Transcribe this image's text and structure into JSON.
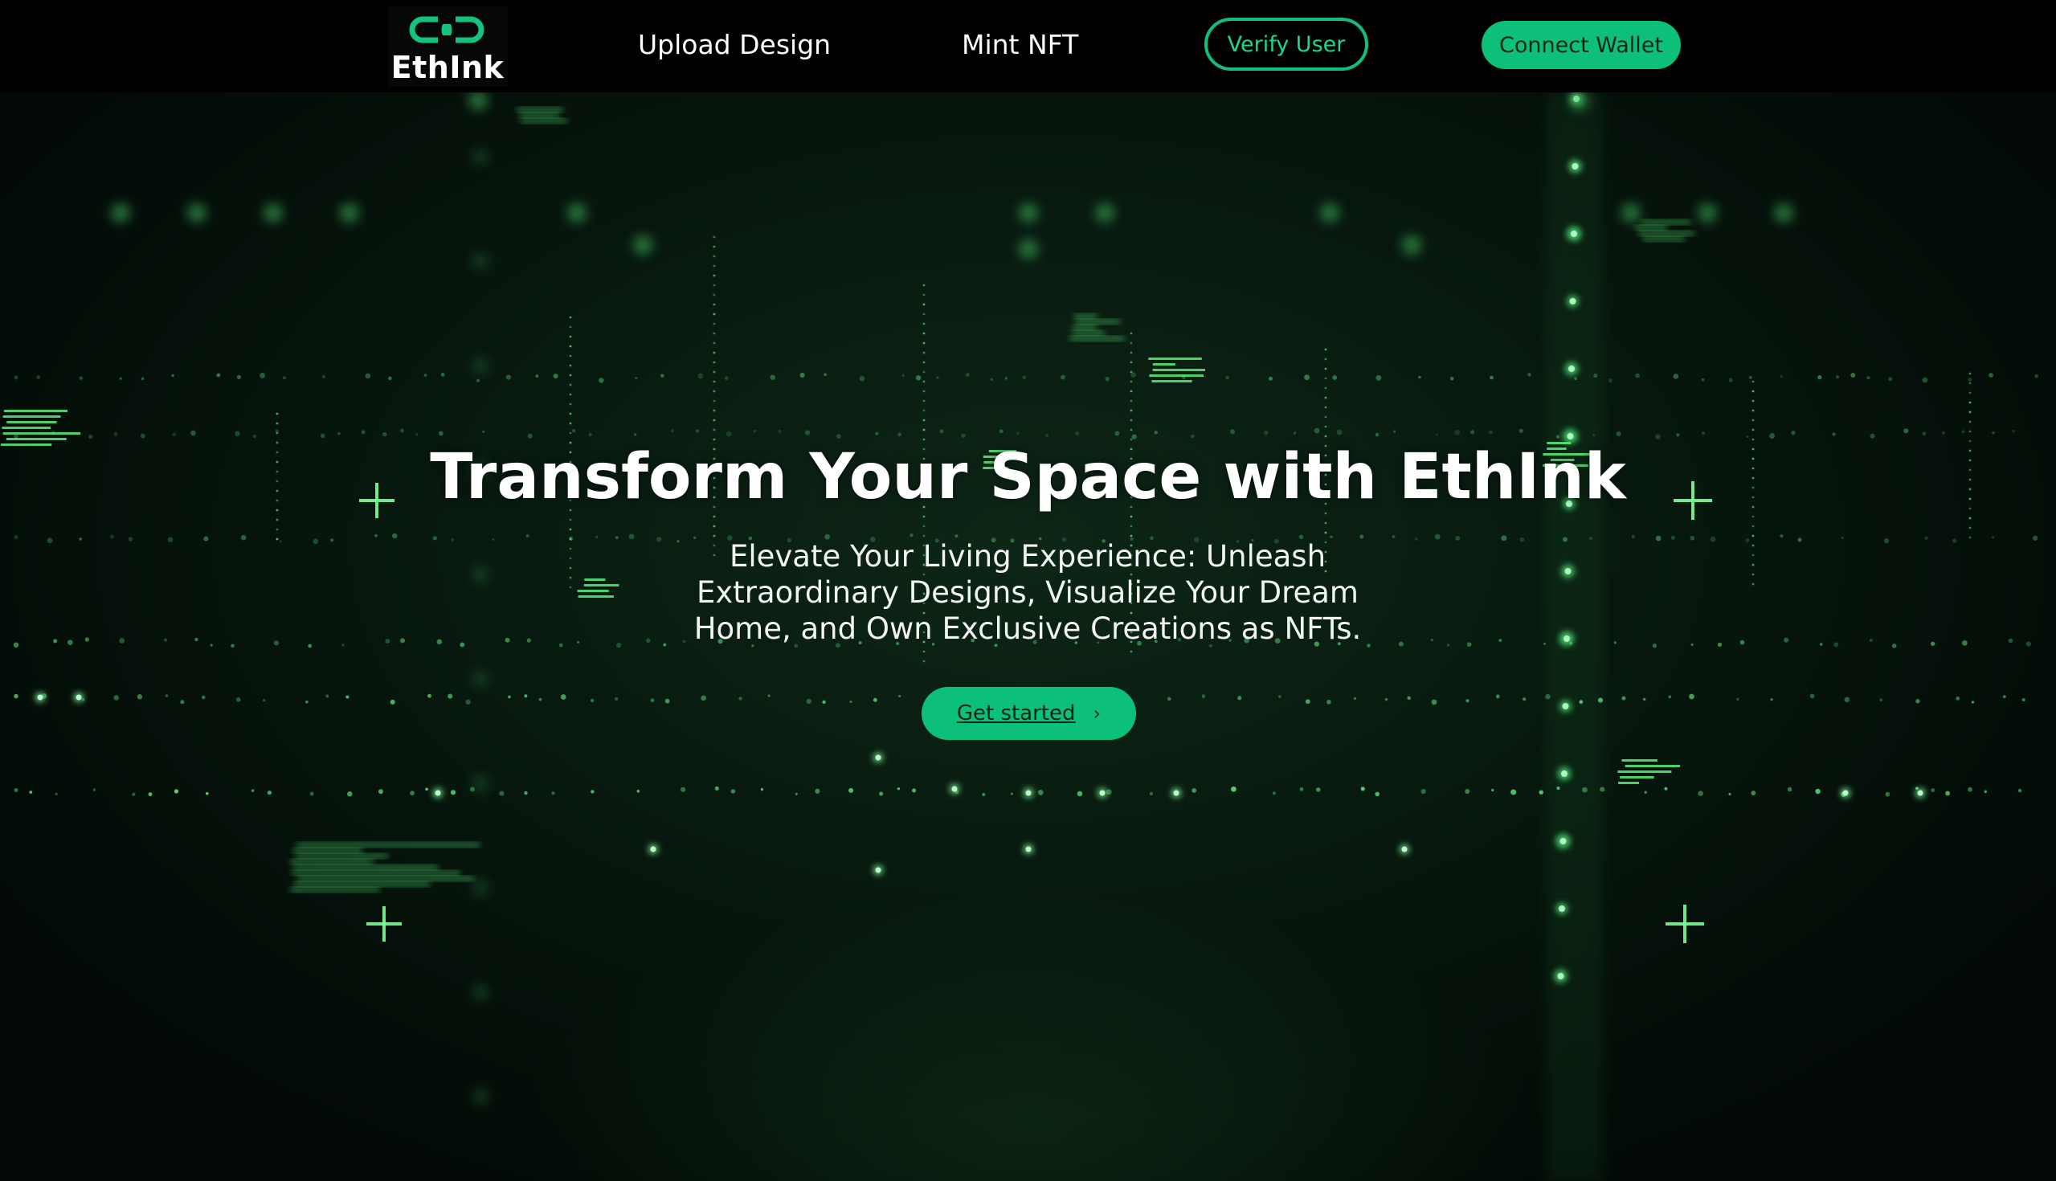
{
  "brand": {
    "name": "EthInk",
    "logo_icon": "chain-link-icon",
    "accent": "#0cc07a"
  },
  "nav": {
    "links": [
      "Upload Design",
      "Mint NFT"
    ],
    "verify_label": "Verify User",
    "connect_label": "Connect Wallet"
  },
  "hero": {
    "title": "Transform Your Space with EthInk",
    "subtitle": "Elevate Your Living Experience: Unleash Extraordinary Designs, Visualize Your Dream Home, and Own Exclusive Creations as NFTs.",
    "cta_label": "Get started",
    "cta_icon": "chevron-right-icon",
    "background": "green digital particle grid"
  }
}
